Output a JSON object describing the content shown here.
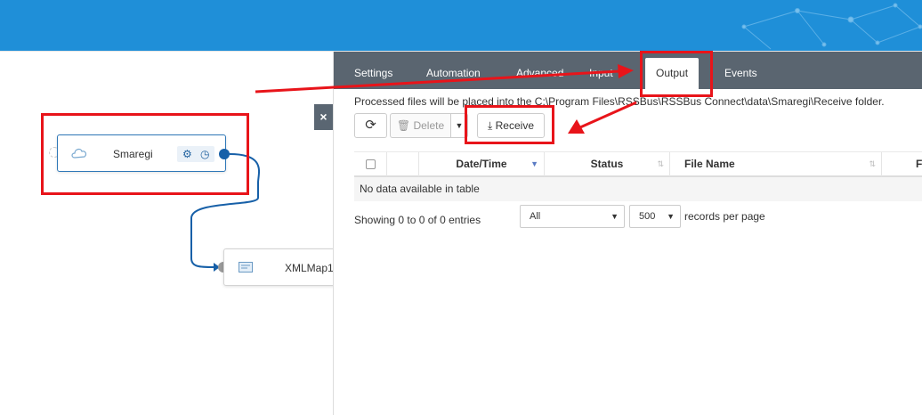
{
  "canvas": {
    "nodes": [
      {
        "name": "Smaregi",
        "icon": "cloud-icon",
        "actions": [
          "gear-icon",
          "clock-icon"
        ]
      },
      {
        "name": "XMLMap1",
        "icon": "map-icon"
      }
    ],
    "close_label": "×"
  },
  "panel": {
    "tabs": [
      "Settings",
      "Automation",
      "Advanced",
      "Input",
      "Output",
      "Events"
    ],
    "active_tab": "Output",
    "info_text": "Processed files will be placed into the C:\\Program Files\\RSSBus\\RSSBus Connect\\data\\Smaregi\\Receive folder.",
    "toolbar": {
      "refresh_icon": "refresh-icon",
      "delete_label": "Delete",
      "delete_icon": "trash-icon",
      "receive_label": "Receive",
      "receive_icon": "download-icon"
    },
    "table": {
      "columns": [
        "",
        "",
        "Date/Time",
        "Status",
        "File Name",
        "Fi"
      ],
      "empty_text": "No data available in table"
    },
    "footer": {
      "showing": "Showing 0 to 0 of 0 entries",
      "filter_value": "All",
      "page_size": "500",
      "per_page_label": "records per page"
    }
  },
  "colors": {
    "banner": "#1f8fd8",
    "tabbar": "#5a6570",
    "annotation": "#e8141a",
    "connector": "#1760a8"
  }
}
